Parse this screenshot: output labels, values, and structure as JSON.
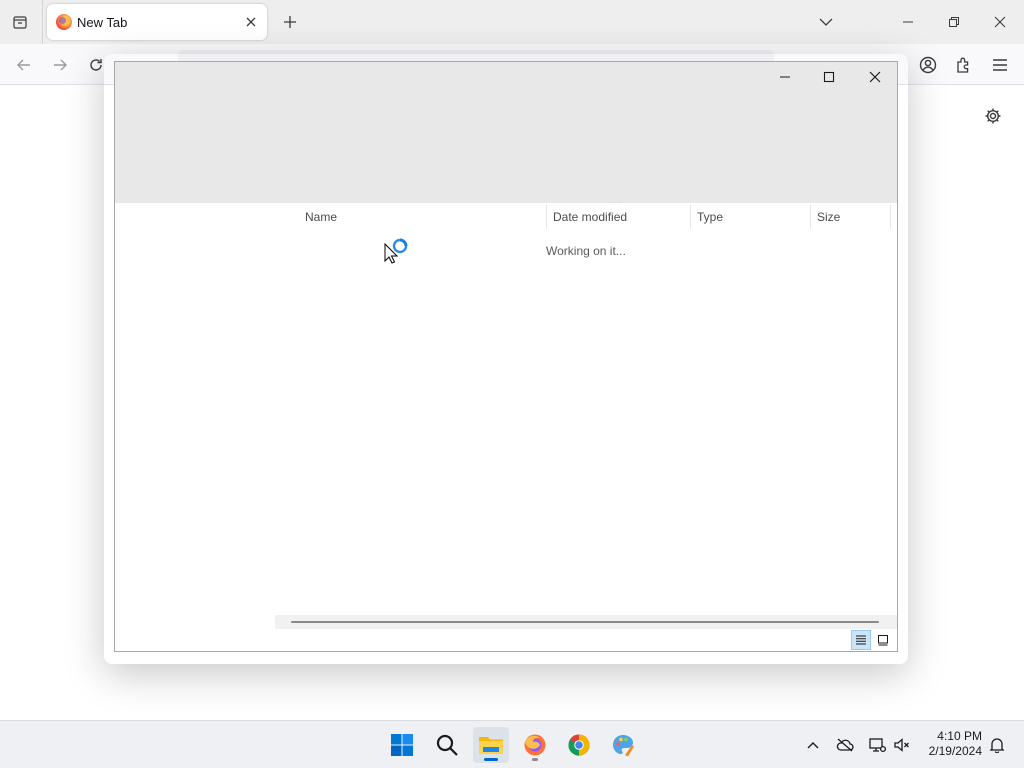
{
  "browser": {
    "tab": {
      "title": "New Tab",
      "favicon": "firefox-icon"
    },
    "icons": {
      "tab_list": "tab-list-icon",
      "close_tab": "close-icon",
      "new_tab": "plus-icon",
      "overflow": "chevron-down-icon",
      "back": "arrow-left-icon",
      "forward": "arrow-right-icon",
      "reload": "reload-icon",
      "account": "account-icon",
      "extensions": "puzzle-icon",
      "menu": "hamburger-icon",
      "settings": "gear-icon"
    }
  },
  "dialog": {
    "columns": [
      {
        "label": "Name"
      },
      {
        "label": "Date modified"
      },
      {
        "label": "Type"
      },
      {
        "label": "Size"
      }
    ],
    "status": "Working on it...",
    "sorted_column": "Date modified",
    "view_modes": [
      "details",
      "large-icons"
    ],
    "active_view": "details"
  },
  "taskbar": {
    "apps": [
      "start",
      "search",
      "file-explorer",
      "firefox",
      "chrome",
      "paint"
    ],
    "active_app": "file-explorer",
    "clock": {
      "time": "4:10 PM",
      "date": "2/19/2024"
    }
  },
  "colors": {
    "accent": "#0067c0",
    "header_bg": "#e8e8e8",
    "taskbar_bg": "#eef0f4"
  }
}
